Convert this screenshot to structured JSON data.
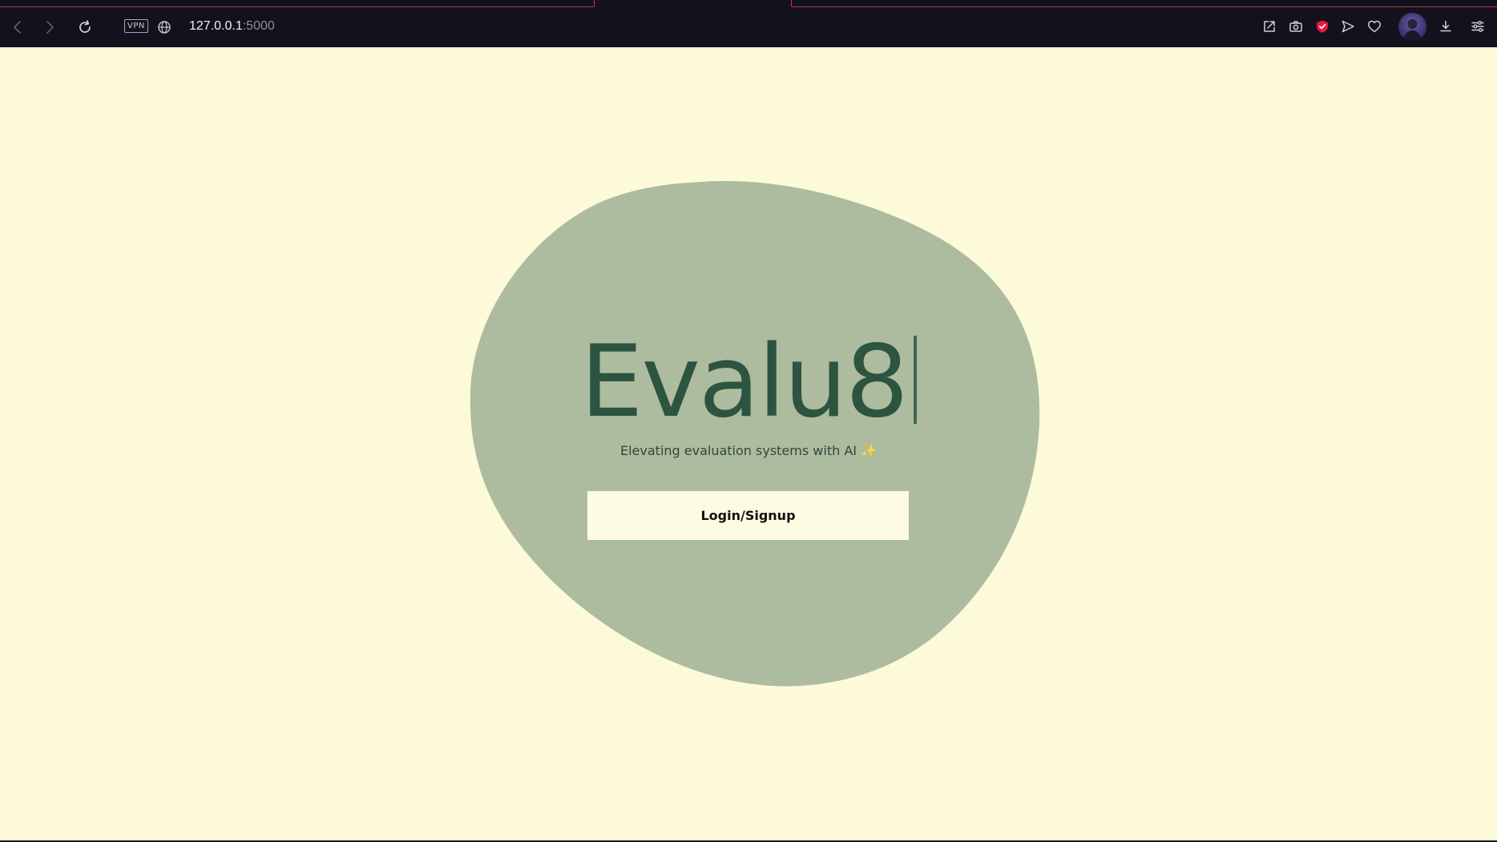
{
  "browser": {
    "url_host": "127.0.0.1",
    "url_rest": ":5000",
    "vpn_label": "VPN",
    "back_icon": "chevron-left-icon",
    "forward_icon": "chevron-right-icon",
    "reload_icon": "reload-icon",
    "toolbar_icons": [
      "share-icon",
      "camera-icon",
      "shield-icon",
      "send-icon",
      "heart-icon",
      "download-icon",
      "settings-icon"
    ],
    "accent_color": "#c4314b"
  },
  "page": {
    "title": "Evalu8",
    "subtitle": "Elevating evaluation systems with AI ✨",
    "login_button_label": "Login/Signup",
    "background_color": "#fcfad9",
    "blob_color": "#adbc9e",
    "title_color": "#2c5440"
  }
}
